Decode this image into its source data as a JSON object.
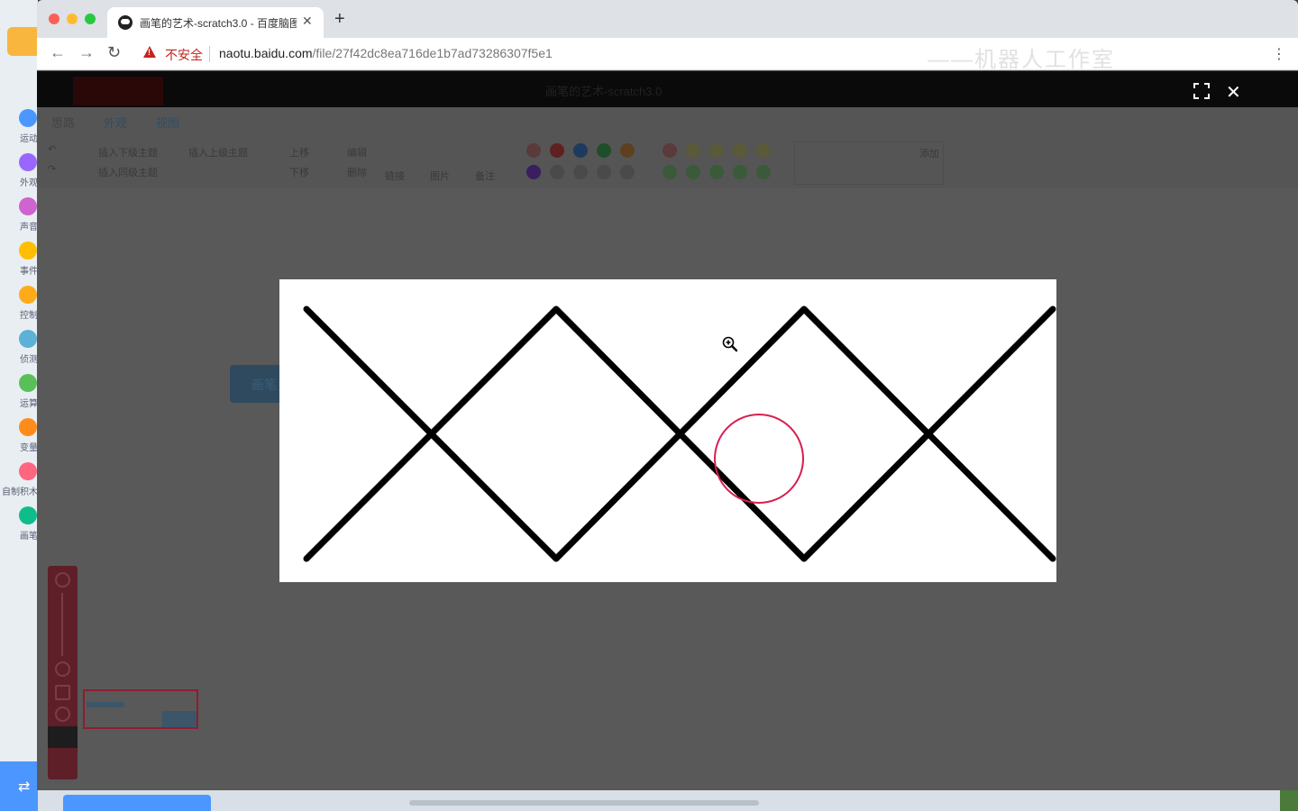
{
  "scratch_sidebar": {
    "categories": [
      {
        "label": "运动",
        "color": "#4c97ff"
      },
      {
        "label": "外观",
        "color": "#9966ff"
      },
      {
        "label": "声音",
        "color": "#cf63cf"
      },
      {
        "label": "事件",
        "color": "#ffbf00"
      },
      {
        "label": "控制",
        "color": "#ffab19"
      },
      {
        "label": "侦测",
        "color": "#5cb1d6"
      },
      {
        "label": "运算",
        "color": "#59c059"
      },
      {
        "label": "变量",
        "color": "#ff8c1a"
      },
      {
        "label": "自制积木",
        "color": "#ff6680"
      },
      {
        "label": "画笔",
        "color": "#0fbd8c"
      }
    ]
  },
  "browser": {
    "tab_title": "画笔的艺术-scratch3.0 - 百度脑图",
    "security_label": "不安全",
    "url_host": "naotu.baidu.com",
    "url_path": "/file/27f42dc8ea716de1b7ad73286307f5e1",
    "watermark": "——机器人工作室"
  },
  "naotu": {
    "header_title": "画笔的艺术-scratch3.0",
    "tabs": [
      "思路",
      "外观",
      "视图"
    ],
    "ribbon": {
      "insert_child": "插入下级主题",
      "insert_parent": "插入上级主题",
      "insert_sibling": "插入同级主题",
      "move_up": "上移",
      "move_down": "下移",
      "edit": "编辑",
      "delete": "删除",
      "link": "链接",
      "image": "图片",
      "note": "备注",
      "add": "添加"
    },
    "node_text": "画笔"
  },
  "lightbox": {
    "image_bg": "#ffffff",
    "stroke_color": "#000000",
    "highlight_color": "#d81e50"
  }
}
